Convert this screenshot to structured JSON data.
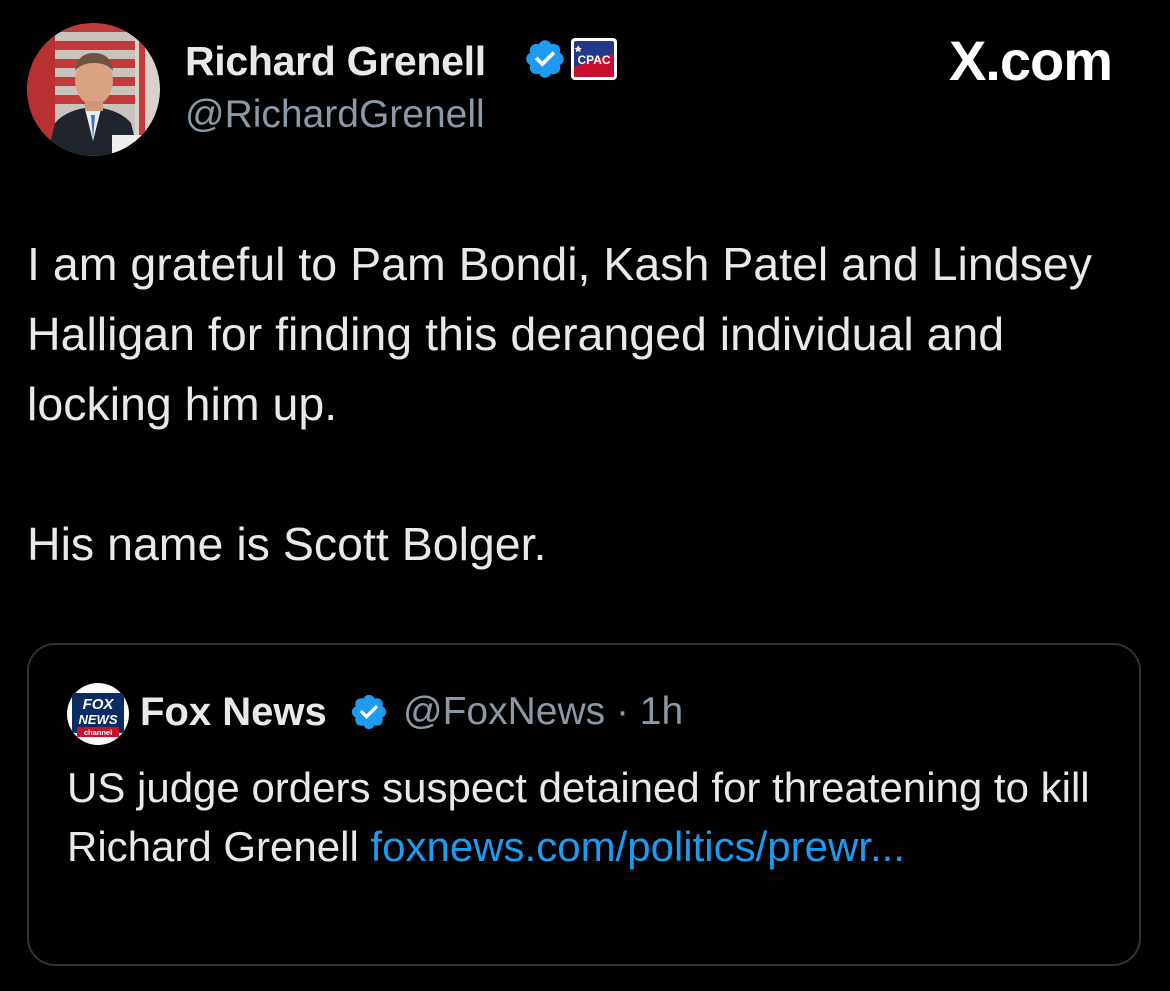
{
  "author": {
    "display_name": "Richard Grenell",
    "handle": "@RichardGrenell",
    "avatar": "profile-photo",
    "verified_icon": "verified-badge-icon",
    "affiliate_badge": "cpac-badge",
    "affiliate_badge_text": "CPAC"
  },
  "brand": {
    "label": "X.com"
  },
  "tweet": {
    "line_1": "I am grateful to Pam Bondi, Kash Patel and Lindsey Halligan for finding this deranged individual and locking him up.",
    "line_2": "His name is Scott Bolger."
  },
  "quoted_tweet": {
    "logo": "fox-news-logo",
    "logo_text_top": "FOX",
    "logo_text_mid": "NEWS",
    "logo_text_bottom": "channel",
    "display_name": "Fox News",
    "verified_icon": "verified-badge-icon",
    "handle_time": "@FoxNews · 1h",
    "text": "US judge orders suspect detained for threatening to kill Richard Grenell ",
    "link": "foxnews.com/politics/prewr..."
  },
  "colors": {
    "background": "#000000",
    "text": "#e7e9ea",
    "secondary_text": "#8b98a5",
    "link": "#1d9bf0",
    "verified": "#1d9bf0",
    "card_border": "#2f3336"
  }
}
